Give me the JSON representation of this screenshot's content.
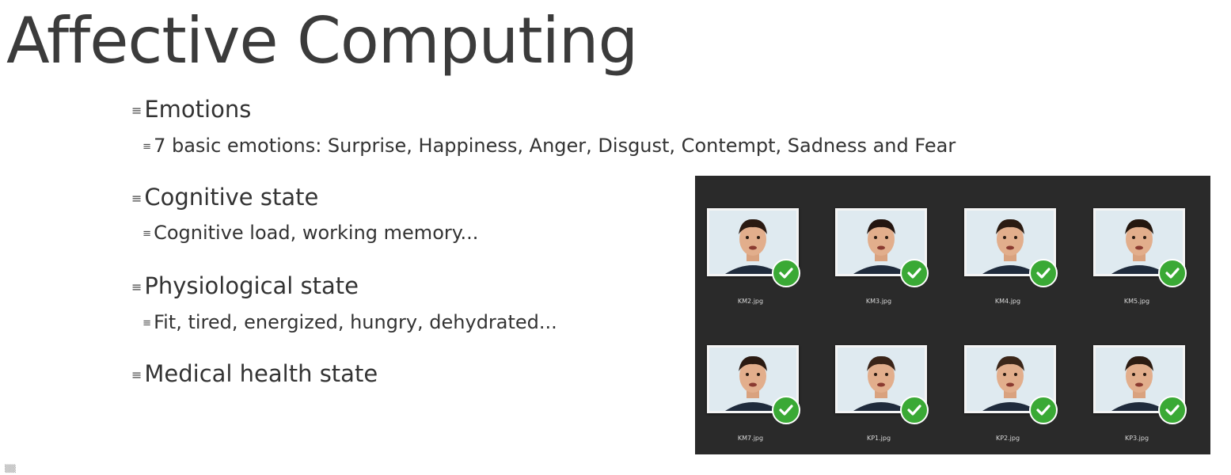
{
  "slide": {
    "title": "Affective Computing",
    "bullet_marker": "≡",
    "items": [
      {
        "label": "Emotions",
        "sub": "7 basic emotions: Surprise, Happiness, Anger, Disgust, Contempt, Sadness and Fear"
      },
      {
        "label": "Cognitive state",
        "sub": "Cognitive load, working memory..."
      },
      {
        "label": "Physiological state",
        "sub": "Fit, tired, energized, hungry, dehydrated..."
      },
      {
        "label": "Medical health state",
        "sub": ""
      }
    ]
  },
  "gallery": {
    "background": "#2a2a2a",
    "check_color": "#3aa935",
    "files": [
      "KM2.jpg",
      "KM3.jpg",
      "KM4.jpg",
      "KM5.jpg",
      "KM7.jpg",
      "KP1.jpg",
      "KP2.jpg",
      "KP3.jpg"
    ]
  }
}
